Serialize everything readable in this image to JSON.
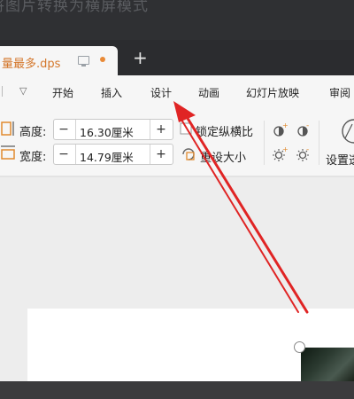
{
  "window": {
    "faint_title": "将图片转换为横屏模式"
  },
  "tab": {
    "name": "量最多.dps",
    "new_tab": "+"
  },
  "menu": {
    "items": [
      "开始",
      "插入",
      "设计",
      "动画",
      "幻灯片放映",
      "审阅"
    ]
  },
  "toolbar": {
    "height_label": "高度:",
    "height_value": "16.30厘米",
    "width_label": "宽度:",
    "width_value": "14.79厘米",
    "minus": "−",
    "plus": "+",
    "lock_ratio": "锁定纵横比",
    "reset_size": "重设大小",
    "settings": "设置透"
  },
  "annotation": {
    "arrow_color": "#e02424"
  },
  "colors": {
    "accent_orange": "#d4762a",
    "tab_dot": "#e98a37"
  }
}
